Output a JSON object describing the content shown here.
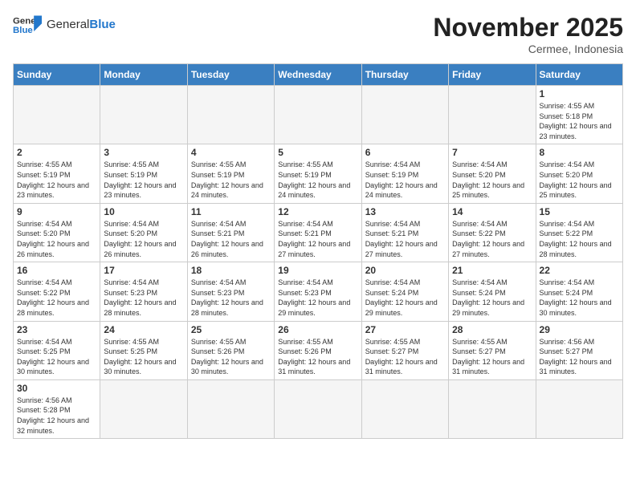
{
  "header": {
    "logo_general": "General",
    "logo_blue": "Blue",
    "month_year": "November 2025",
    "location": "Cermee, Indonesia"
  },
  "weekdays": [
    "Sunday",
    "Monday",
    "Tuesday",
    "Wednesday",
    "Thursday",
    "Friday",
    "Saturday"
  ],
  "weeks": [
    [
      {
        "day": "",
        "info": ""
      },
      {
        "day": "",
        "info": ""
      },
      {
        "day": "",
        "info": ""
      },
      {
        "day": "",
        "info": ""
      },
      {
        "day": "",
        "info": ""
      },
      {
        "day": "",
        "info": ""
      },
      {
        "day": "1",
        "info": "Sunrise: 4:55 AM\nSunset: 5:18 PM\nDaylight: 12 hours and 23 minutes."
      }
    ],
    [
      {
        "day": "2",
        "info": "Sunrise: 4:55 AM\nSunset: 5:19 PM\nDaylight: 12 hours and 23 minutes."
      },
      {
        "day": "3",
        "info": "Sunrise: 4:55 AM\nSunset: 5:19 PM\nDaylight: 12 hours and 23 minutes."
      },
      {
        "day": "4",
        "info": "Sunrise: 4:55 AM\nSunset: 5:19 PM\nDaylight: 12 hours and 24 minutes."
      },
      {
        "day": "5",
        "info": "Sunrise: 4:55 AM\nSunset: 5:19 PM\nDaylight: 12 hours and 24 minutes."
      },
      {
        "day": "6",
        "info": "Sunrise: 4:54 AM\nSunset: 5:19 PM\nDaylight: 12 hours and 24 minutes."
      },
      {
        "day": "7",
        "info": "Sunrise: 4:54 AM\nSunset: 5:20 PM\nDaylight: 12 hours and 25 minutes."
      },
      {
        "day": "8",
        "info": "Sunrise: 4:54 AM\nSunset: 5:20 PM\nDaylight: 12 hours and 25 minutes."
      }
    ],
    [
      {
        "day": "9",
        "info": "Sunrise: 4:54 AM\nSunset: 5:20 PM\nDaylight: 12 hours and 26 minutes."
      },
      {
        "day": "10",
        "info": "Sunrise: 4:54 AM\nSunset: 5:20 PM\nDaylight: 12 hours and 26 minutes."
      },
      {
        "day": "11",
        "info": "Sunrise: 4:54 AM\nSunset: 5:21 PM\nDaylight: 12 hours and 26 minutes."
      },
      {
        "day": "12",
        "info": "Sunrise: 4:54 AM\nSunset: 5:21 PM\nDaylight: 12 hours and 27 minutes."
      },
      {
        "day": "13",
        "info": "Sunrise: 4:54 AM\nSunset: 5:21 PM\nDaylight: 12 hours and 27 minutes."
      },
      {
        "day": "14",
        "info": "Sunrise: 4:54 AM\nSunset: 5:22 PM\nDaylight: 12 hours and 27 minutes."
      },
      {
        "day": "15",
        "info": "Sunrise: 4:54 AM\nSunset: 5:22 PM\nDaylight: 12 hours and 28 minutes."
      }
    ],
    [
      {
        "day": "16",
        "info": "Sunrise: 4:54 AM\nSunset: 5:22 PM\nDaylight: 12 hours and 28 minutes."
      },
      {
        "day": "17",
        "info": "Sunrise: 4:54 AM\nSunset: 5:23 PM\nDaylight: 12 hours and 28 minutes."
      },
      {
        "day": "18",
        "info": "Sunrise: 4:54 AM\nSunset: 5:23 PM\nDaylight: 12 hours and 28 minutes."
      },
      {
        "day": "19",
        "info": "Sunrise: 4:54 AM\nSunset: 5:23 PM\nDaylight: 12 hours and 29 minutes."
      },
      {
        "day": "20",
        "info": "Sunrise: 4:54 AM\nSunset: 5:24 PM\nDaylight: 12 hours and 29 minutes."
      },
      {
        "day": "21",
        "info": "Sunrise: 4:54 AM\nSunset: 5:24 PM\nDaylight: 12 hours and 29 minutes."
      },
      {
        "day": "22",
        "info": "Sunrise: 4:54 AM\nSunset: 5:24 PM\nDaylight: 12 hours and 30 minutes."
      }
    ],
    [
      {
        "day": "23",
        "info": "Sunrise: 4:54 AM\nSunset: 5:25 PM\nDaylight: 12 hours and 30 minutes."
      },
      {
        "day": "24",
        "info": "Sunrise: 4:55 AM\nSunset: 5:25 PM\nDaylight: 12 hours and 30 minutes."
      },
      {
        "day": "25",
        "info": "Sunrise: 4:55 AM\nSunset: 5:26 PM\nDaylight: 12 hours and 30 minutes."
      },
      {
        "day": "26",
        "info": "Sunrise: 4:55 AM\nSunset: 5:26 PM\nDaylight: 12 hours and 31 minutes."
      },
      {
        "day": "27",
        "info": "Sunrise: 4:55 AM\nSunset: 5:27 PM\nDaylight: 12 hours and 31 minutes."
      },
      {
        "day": "28",
        "info": "Sunrise: 4:55 AM\nSunset: 5:27 PM\nDaylight: 12 hours and 31 minutes."
      },
      {
        "day": "29",
        "info": "Sunrise: 4:56 AM\nSunset: 5:27 PM\nDaylight: 12 hours and 31 minutes."
      }
    ],
    [
      {
        "day": "30",
        "info": "Sunrise: 4:56 AM\nSunset: 5:28 PM\nDaylight: 12 hours and 32 minutes."
      },
      {
        "day": "",
        "info": ""
      },
      {
        "day": "",
        "info": ""
      },
      {
        "day": "",
        "info": ""
      },
      {
        "day": "",
        "info": ""
      },
      {
        "day": "",
        "info": ""
      },
      {
        "day": "",
        "info": ""
      }
    ]
  ]
}
